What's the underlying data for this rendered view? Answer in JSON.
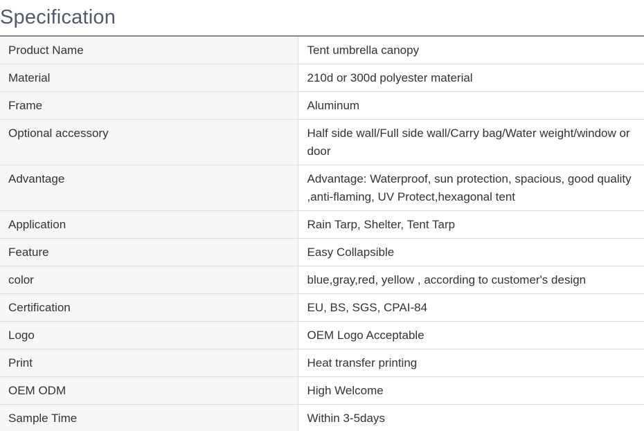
{
  "heading": "Specification",
  "rows": [
    {
      "label": "Product Name",
      "value": "Tent umbrella canopy"
    },
    {
      "label": "Material",
      "value": "210d or 300d polyester material"
    },
    {
      "label": "Frame",
      "value": "Aluminum"
    },
    {
      "label": "Optional accessory",
      "value": "Half side wall/Full side wall/Carry bag/Water weight/window or door"
    },
    {
      "label": "Advantage",
      "value": "Advantage: Waterproof, sun protection, spacious, good quality ,anti-flaming, UV Protect,hexagonal tent"
    },
    {
      "label": "Application",
      "value": "Rain Tarp, Shelter, Tent Tarp"
    },
    {
      "label": "Feature",
      "value": "Easy Collapsible"
    },
    {
      "label": "color",
      "value": "blue,gray,red, yellow , according to customer's design"
    },
    {
      "label": "Certification",
      "value": "EU, BS, SGS, CPAI-84"
    },
    {
      "label": "Logo",
      "value": "OEM Logo Acceptable"
    },
    {
      "label": "Print",
      "value": "Heat transfer printing"
    },
    {
      "label": "OEM ODM",
      "value": "High Welcome"
    },
    {
      "label": "Sample Time",
      "value": "Within 3-5days"
    }
  ]
}
